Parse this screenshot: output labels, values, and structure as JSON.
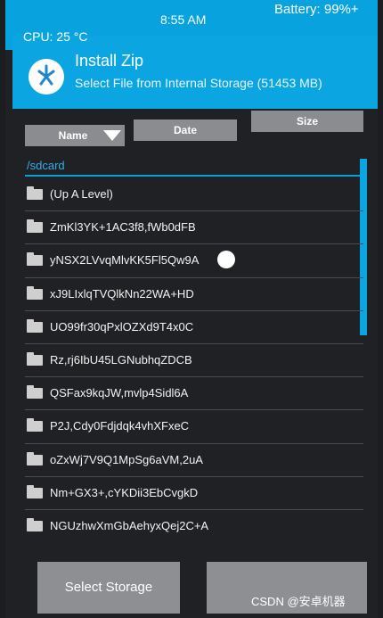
{
  "status_bar": {
    "cpu": "CPU: 25 °C",
    "time": "8:55 AM",
    "battery": "Battery: 99%+"
  },
  "header": {
    "title": "Install Zip",
    "subtitle": "Select File from Internal Storage (51453 MB)",
    "logo_icon": "twrp-logo-icon"
  },
  "sort": {
    "name_label": "Name",
    "date_label": "Date",
    "size_label": "Size"
  },
  "path": "/sdcard",
  "items": [
    "(Up A Level)",
    "ZmKl3YK+1AC3f8,fWb0dFB",
    "yNSX2LVvqMlvKK5Fl5Qw9A",
    "xJ9LIxlqTVQlkNn22WA+HD",
    "UO99fr30qPxlOZXd9T4x0C",
    "Rz,rj6IbU45LGNubhqZDCB",
    "QSFax9kqJW,mvlp4Sidl6A",
    "P2J,Cdy0Fdjdqk4vhXFxeC",
    "oZxWj7V9Q1MpSg6aVM,2uA",
    "Nm+GX3+,cYKDii3EbCvgkD",
    "NGUzhwXmGbAehyxQej2C+A"
  ],
  "bottom": {
    "select_storage": "Select Storage",
    "right_button": ""
  },
  "watermark": "CSDN @安卓机器",
  "colors": {
    "accent": "#0ba6e2",
    "background": "#1f2124",
    "button": "#8a8c8f"
  }
}
